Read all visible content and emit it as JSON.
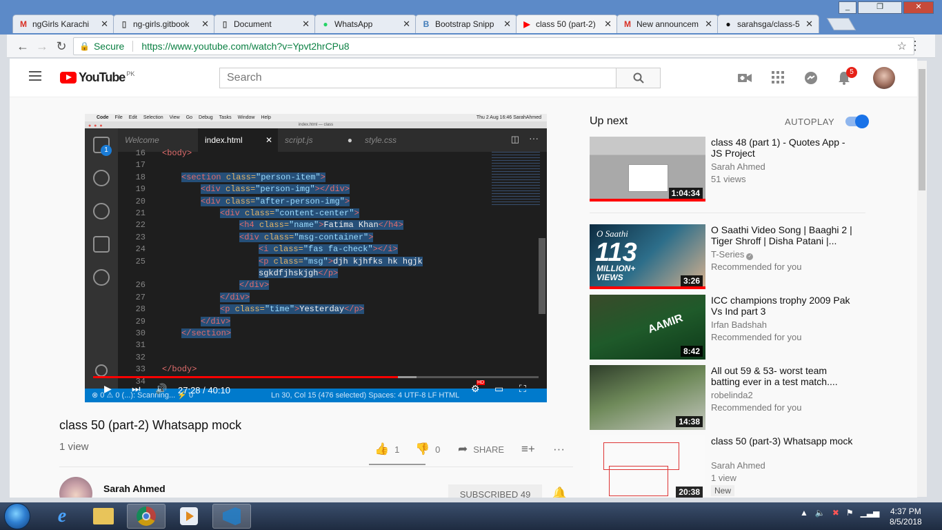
{
  "browser": {
    "tabs": [
      {
        "label": "ngGirls Karachi",
        "icon": "gmail-icon",
        "color": "#d93025"
      },
      {
        "label": "ng-girls.gitbook",
        "icon": "document-icon",
        "color": "#555555"
      },
      {
        "label": "Document",
        "icon": "document-icon",
        "color": "#555555"
      },
      {
        "label": "WhatsApp",
        "icon": "whatsapp-icon",
        "color": "#25d366"
      },
      {
        "label": "Bootstrap Snipp",
        "icon": "bootstrap-icon",
        "color": "#3f7bb8"
      },
      {
        "label": "class 50 (part-2)",
        "icon": "youtube-icon",
        "color": "#ff0000"
      },
      {
        "label": "New announcem",
        "icon": "gmail-icon",
        "color": "#d93025"
      },
      {
        "label": "sarahsga/class-5",
        "icon": "github-icon",
        "color": "#111111"
      }
    ],
    "tab_close": "✕",
    "window_buttons": [
      "_",
      "❐",
      "✕"
    ],
    "secure_label": "Secure",
    "url": "https://www.youtube.com/watch?v=Ypvt2hrCPu8"
  },
  "youtube": {
    "logo_text": "YouTube",
    "region": "PK",
    "search_placeholder": "Search",
    "notification_count": "5"
  },
  "video": {
    "mac_menu": [
      "Code",
      "File",
      "Edit",
      "Selection",
      "View",
      "Go",
      "Debug",
      "Tasks",
      "Window",
      "Help"
    ],
    "mac_status": "Thu 2 Aug  16:46   SarahAhmed",
    "window_title": "index.html — class",
    "explorer_badge": "1",
    "editor_tabs": [
      "Welcome",
      "index.html",
      "script.js",
      "style.css"
    ],
    "active_tab_close": "✕",
    "code_lines": [
      {
        "n": "16",
        "html": "<span class='tg'>&lt;body&gt;</span>",
        "sel": false,
        "indent": 0
      },
      {
        "n": "17",
        "html": "",
        "sel": false,
        "indent": 0
      },
      {
        "n": "18",
        "html": "<span class='tg'>&lt;section</span> <span class='at'>class=</span><span class='st'>\"person-item\"</span><span class='tg'>&gt;</span>",
        "sel": true,
        "indent": 1
      },
      {
        "n": "19",
        "html": "<span class='tg'>&lt;div</span> <span class='at'>class=</span><span class='st'>\"person-img\"</span><span class='tg'>&gt;&lt;/div&gt;</span>",
        "sel": true,
        "indent": 2
      },
      {
        "n": "20",
        "html": "<span class='tg'>&lt;div</span> <span class='at'>class=</span><span class='st'>\"after-person-img\"</span><span class='tg'>&gt;</span>",
        "sel": true,
        "indent": 2
      },
      {
        "n": "21",
        "html": "<span class='tg'>&lt;div</span> <span class='at'>class=</span><span class='st'>\"content-center\"</span><span class='tg'>&gt;</span>",
        "sel": true,
        "indent": 3
      },
      {
        "n": "22",
        "html": "<span class='tg'>&lt;h4</span> <span class='at'>class=</span><span class='st'>\"name\"</span><span class='tg'>&gt;</span><span class='txt'>Fatima Khan</span><span class='tg'>&lt;/h4&gt;</span>",
        "sel": true,
        "indent": 4
      },
      {
        "n": "23",
        "html": "<span class='tg'>&lt;div</span> <span class='at'>class=</span><span class='st'>\"msg-container\"</span><span class='tg'>&gt;</span>",
        "sel": true,
        "indent": 4
      },
      {
        "n": "24",
        "html": "<span class='tg'>&lt;i</span> <span class='at'>class=</span><span class='st'>\"fas fa-check\"</span><span class='tg'>&gt;&lt;/i&gt;</span>",
        "sel": true,
        "indent": 5
      },
      {
        "n": "25",
        "html": "<span class='tg'>&lt;p</span> <span class='at'>class=</span><span class='st'>\"msg\"</span><span class='tg'>&gt;</span><span class='txt'>djh kjhfks hk hgjk</span>",
        "sel": true,
        "indent": 5
      },
      {
        "n": "",
        "html": "<span class='txt'>sgkdfjhskjgh</span><span class='tg'>&lt;/p&gt;</span>",
        "sel": true,
        "indent": 5
      },
      {
        "n": "26",
        "html": "<span class='tg'>&lt;/div&gt;</span>",
        "sel": true,
        "indent": 4
      },
      {
        "n": "27",
        "html": "<span class='tg'>&lt;/div&gt;</span>",
        "sel": true,
        "indent": 3
      },
      {
        "n": "28",
        "html": "<span class='tg'>&lt;p</span> <span class='at'>class=</span><span class='st'>\"time\"</span><span class='tg'>&gt;</span><span class='txt'>Yesterday</span><span class='tg'>&lt;/p&gt;</span>",
        "sel": true,
        "indent": 3
      },
      {
        "n": "29",
        "html": "<span class='tg'>&lt;/div&gt;</span>",
        "sel": true,
        "indent": 2
      },
      {
        "n": "30",
        "html": "<span class='tg'>&lt;/section&gt;</span>",
        "sel": true,
        "indent": 1
      },
      {
        "n": "31",
        "html": "",
        "sel": false,
        "indent": 0
      },
      {
        "n": "32",
        "html": "",
        "sel": false,
        "indent": 0
      },
      {
        "n": "33",
        "html": "<span class='tg'>&lt;/body&gt;</span>",
        "sel": false,
        "indent": 0
      },
      {
        "n": "34",
        "html": "",
        "sel": false,
        "indent": 0
      }
    ],
    "status_left": "⊗ 0  ⚠ 0   (...): Scanning...   ⚡ 0",
    "status_right": "Ln 30, Col 15 (476 selected)    Spaces: 4    UTF-8    LF    HTML",
    "time_current": "27:28",
    "time_total": "40:10",
    "progress": 0.684,
    "hd_badge": "HD"
  },
  "meta": {
    "title": "class 50 (part-2) Whatsapp mock",
    "views": "1 view",
    "likes": "1",
    "dislikes": "0",
    "share_label": "SHARE",
    "channel": "Sarah Ahmed",
    "subscribe_label": "SUBSCRIBED  49"
  },
  "sidebar": {
    "up_next": "Up next",
    "autoplay": "AUTOPLAY",
    "autoplay_on": true,
    "items": [
      {
        "title": "class 48 (part 1) - Quotes App - JS Project",
        "channel": "Sarah Ahmed",
        "meta": "51 views",
        "duration": "1:04:34",
        "verified": false,
        "new": "",
        "progress": 1.0
      },
      {
        "title": "O Saathi Video Song | Baaghi 2 | Tiger Shroff | Disha Patani |...",
        "channel": "T-Series",
        "meta": "Recommended for you",
        "duration": "3:26",
        "verified": true,
        "new": "",
        "progress": 1.0
      },
      {
        "title": "ICC champions trophy 2009 Pak Vs Ind part 3",
        "channel": "Irfan Badshah",
        "meta": "Recommended for you",
        "duration": "8:42",
        "verified": false,
        "new": "",
        "progress": 0
      },
      {
        "title": "All out 59 & 53- worst team batting ever in a test match....",
        "channel": "robelinda2",
        "meta": "Recommended for you",
        "duration": "14:38",
        "verified": false,
        "new": "",
        "progress": 0
      },
      {
        "title": "class 50 (part-3) Whatsapp mock",
        "channel": "Sarah Ahmed",
        "meta": "1 view",
        "duration": "20:38",
        "verified": false,
        "new": "New",
        "progress": 0
      }
    ],
    "thumb_texts": {
      "saathi_big": "113",
      "saathi_small": "MILLION+ VIEWS",
      "saathi_script": "O Saathi",
      "cricket_name": "AAMIR"
    }
  },
  "taskbar": {
    "time": "4:37 PM",
    "date": "8/5/2018"
  }
}
